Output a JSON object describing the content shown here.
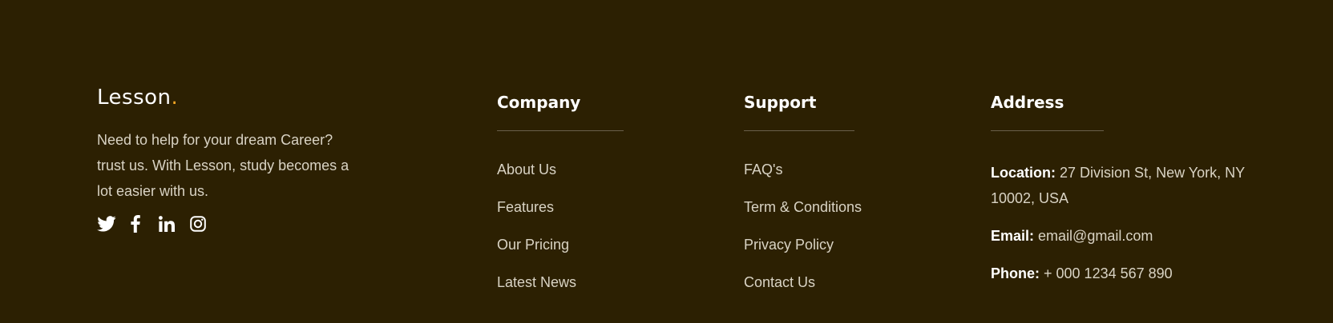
{
  "brand": {
    "name": "Lesson",
    "dot": ".",
    "tagline": "Need to help for your dream Career? trust us. With Lesson, study becomes a lot easier with us.",
    "accent_color": "#f5a623"
  },
  "socials": [
    {
      "icon": "twitter-icon"
    },
    {
      "icon": "facebook-icon"
    },
    {
      "icon": "linkedin-icon"
    },
    {
      "icon": "instagram-icon"
    }
  ],
  "company": {
    "title": "Company",
    "links": [
      "About Us",
      "Features",
      "Our Pricing",
      "Latest News"
    ]
  },
  "support": {
    "title": "Support",
    "links": [
      "FAQ's",
      "Term & Conditions",
      "Privacy Policy",
      "Contact Us"
    ]
  },
  "address": {
    "title": "Address",
    "location_label": "Location:",
    "location_value": "27 Division St, New York, NY 10002, USA",
    "email_label": "Email:",
    "email_value": "email@gmail.com",
    "phone_label": "Phone:",
    "phone_value": "+ 000 1234 567 890"
  },
  "colors": {
    "background": "#2c2002",
    "heading": "#ffffff",
    "text": "#d9d3c4",
    "divider": "#6a5f4a"
  }
}
